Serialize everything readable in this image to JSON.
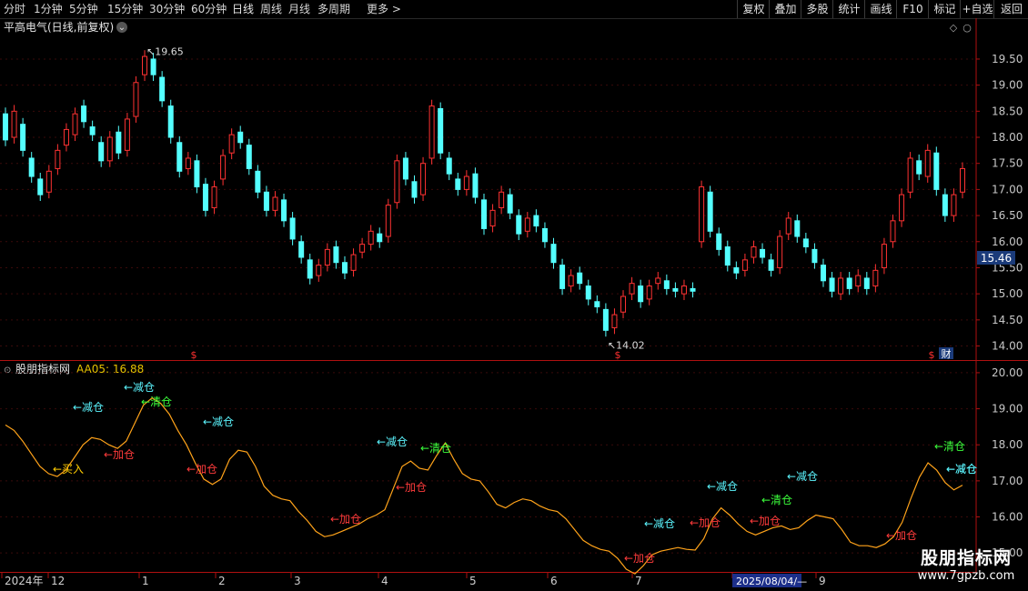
{
  "toolbar": {
    "periods": [
      "分时",
      "1分钟",
      "5分钟",
      "15分钟",
      "30分钟",
      "60分钟",
      "日线",
      "周线",
      "月线",
      "多周期",
      "更多 >"
    ],
    "active_period": "日线",
    "right_buttons": [
      "复权",
      "叠加",
      "多股",
      "统计",
      "画线",
      "F10",
      "标记",
      "+自选",
      "返回"
    ]
  },
  "main_panel": {
    "title": "平高电气(日线,前复权)",
    "high_label": "19.65",
    "low_label": "14.02",
    "current_price": "15.46",
    "price_axis": [
      "19.50",
      "19.00",
      "18.50",
      "18.00",
      "17.50",
      "17.00",
      "16.50",
      "16.00",
      "15.50",
      "15.00",
      "14.50",
      "14.00"
    ],
    "markers": [
      "$",
      "$",
      "$"
    ],
    "finance_badge": "财"
  },
  "indicator_panel": {
    "title": "股朋指标网",
    "value_label": "AA05: 16.88",
    "axis": [
      "20.00",
      "19.00",
      "18.00",
      "17.00",
      "16.00",
      "15.00"
    ],
    "signals": [
      "←减仓",
      "←减仓",
      "←清仓",
      "←加仓",
      "←买入",
      "←减仓",
      "←加仓",
      "←减仓",
      "←清仓",
      "←加仓",
      "←加仓",
      "←减仓",
      "←加仓",
      "←减仓",
      "←加仓",
      "←减仓",
      "←清仓",
      "←加仓",
      "←减仓",
      "←加仓",
      "←减仓",
      "←清仓"
    ]
  },
  "time_axis": {
    "labels": [
      "2024年",
      "12",
      "1",
      "2",
      "3",
      "4",
      "5",
      "6",
      "7",
      "2025/08/04/—",
      "9"
    ]
  },
  "watermark": {
    "name": "股朋指标网",
    "url": "www.7gpzb.com"
  },
  "colors": {
    "up": "#ff3232",
    "down": "#54ffff",
    "indicator_line": "#ffa31a",
    "axis": "#b01010",
    "add": "#ff3b3b",
    "reduce": "#5cf6ff",
    "clear": "#3cff3c",
    "buy": "#ffcc00"
  },
  "chart_data": {
    "type": "candlestick",
    "y_range": [
      13.8,
      19.9
    ],
    "high": 19.65,
    "low": 14.02,
    "last": 15.46,
    "indicator": {
      "name": "AA05",
      "last": 16.88,
      "y_range": [
        14.6,
        20.2
      ],
      "values": [
        18.55,
        18.4,
        18.1,
        17.75,
        17.4,
        17.2,
        17.12,
        17.3,
        17.65,
        18.0,
        18.2,
        18.15,
        18.0,
        17.9,
        18.1,
        18.6,
        19.1,
        19.3,
        19.15,
        18.85,
        18.4,
        18.0,
        17.5,
        17.05,
        16.9,
        17.05,
        17.6,
        17.85,
        17.8,
        17.4,
        16.85,
        16.6,
        16.5,
        16.45,
        16.15,
        15.9,
        15.6,
        15.45,
        15.5,
        15.6,
        15.7,
        15.8,
        15.95,
        16.05,
        16.2,
        16.8,
        17.4,
        17.55,
        17.35,
        17.3,
        17.7,
        18.05,
        17.6,
        17.2,
        17.05,
        17.0,
        16.7,
        16.35,
        16.25,
        16.4,
        16.5,
        16.45,
        16.3,
        16.2,
        16.15,
        15.95,
        15.65,
        15.35,
        15.2,
        15.1,
        15.05,
        14.85,
        14.55,
        14.42,
        14.65,
        14.95,
        15.05,
        15.1,
        15.15,
        15.1,
        15.08,
        15.4,
        15.95,
        16.25,
        16.05,
        15.8,
        15.6,
        15.5,
        15.6,
        15.7,
        15.75,
        15.65,
        15.7,
        15.9,
        16.05,
        16.0,
        15.95,
        15.65,
        15.3,
        15.2,
        15.2,
        15.15,
        15.25,
        15.45,
        15.85,
        16.5,
        17.1,
        17.5,
        17.3,
        16.95,
        16.75,
        16.88
      ]
    },
    "candles": [
      {
        "o": 18.45,
        "c": 17.95
      },
      {
        "o": 18.0,
        "c": 18.5
      },
      {
        "o": 18.25,
        "c": 17.75
      },
      {
        "o": 17.6,
        "c": 17.25
      },
      {
        "o": 17.2,
        "c": 16.9
      },
      {
        "o": 16.95,
        "c": 17.35
      },
      {
        "o": 17.4,
        "c": 17.75
      },
      {
        "o": 17.85,
        "c": 18.15
      },
      {
        "o": 18.05,
        "c": 18.45
      },
      {
        "o": 18.6,
        "c": 18.3
      },
      {
        "o": 18.2,
        "c": 18.05
      },
      {
        "o": 17.9,
        "c": 17.55
      },
      {
        "o": 17.55,
        "c": 18.0
      },
      {
        "o": 18.1,
        "c": 17.7
      },
      {
        "o": 17.75,
        "c": 18.35
      },
      {
        "o": 18.4,
        "c": 19.05
      },
      {
        "o": 19.2,
        "c": 19.55
      },
      {
        "o": 19.5,
        "c": 19.2
      },
      {
        "o": 19.15,
        "c": 18.7
      },
      {
        "o": 18.6,
        "c": 18.0
      },
      {
        "o": 17.9,
        "c": 17.35
      },
      {
        "o": 17.4,
        "c": 17.6
      },
      {
        "o": 17.55,
        "c": 17.05
      },
      {
        "o": 17.1,
        "c": 16.6
      },
      {
        "o": 16.65,
        "c": 17.05
      },
      {
        "o": 17.2,
        "c": 17.65
      },
      {
        "o": 17.7,
        "c": 18.05
      },
      {
        "o": 18.1,
        "c": 17.9
      },
      {
        "o": 17.85,
        "c": 17.4
      },
      {
        "o": 17.35,
        "c": 16.95
      },
      {
        "o": 16.95,
        "c": 16.6
      },
      {
        "o": 16.6,
        "c": 16.85
      },
      {
        "o": 16.8,
        "c": 16.4
      },
      {
        "o": 16.45,
        "c": 16.05
      },
      {
        "o": 16.0,
        "c": 15.7
      },
      {
        "o": 15.65,
        "c": 15.3
      },
      {
        "o": 15.35,
        "c": 15.55
      },
      {
        "o": 15.55,
        "c": 15.85
      },
      {
        "o": 15.9,
        "c": 15.6
      },
      {
        "o": 15.6,
        "c": 15.4
      },
      {
        "o": 15.45,
        "c": 15.75
      },
      {
        "o": 15.8,
        "c": 15.95
      },
      {
        "o": 15.95,
        "c": 16.2
      },
      {
        "o": 16.15,
        "c": 16.0
      },
      {
        "o": 16.1,
        "c": 16.7
      },
      {
        "o": 16.75,
        "c": 17.55
      },
      {
        "o": 17.6,
        "c": 17.2
      },
      {
        "o": 17.15,
        "c": 16.85
      },
      {
        "o": 16.9,
        "c": 17.5
      },
      {
        "o": 17.6,
        "c": 18.6
      },
      {
        "o": 18.55,
        "c": 17.7
      },
      {
        "o": 17.6,
        "c": 17.3
      },
      {
        "o": 17.2,
        "c": 17.0
      },
      {
        "o": 17.0,
        "c": 17.25
      },
      {
        "o": 17.3,
        "c": 16.85
      },
      {
        "o": 16.8,
        "c": 16.25
      },
      {
        "o": 16.3,
        "c": 16.6
      },
      {
        "o": 16.65,
        "c": 16.95
      },
      {
        "o": 16.9,
        "c": 16.55
      },
      {
        "o": 16.5,
        "c": 16.15
      },
      {
        "o": 16.2,
        "c": 16.45
      },
      {
        "o": 16.5,
        "c": 16.3
      },
      {
        "o": 16.25,
        "c": 16.0
      },
      {
        "o": 15.95,
        "c": 15.6
      },
      {
        "o": 15.55,
        "c": 15.1
      },
      {
        "o": 15.15,
        "c": 15.35
      },
      {
        "o": 15.4,
        "c": 15.2
      },
      {
        "o": 15.15,
        "c": 14.9
      },
      {
        "o": 14.85,
        "c": 14.75
      },
      {
        "o": 14.7,
        "c": 14.3
      },
      {
        "o": 14.35,
        "c": 14.6
      },
      {
        "o": 14.65,
        "c": 14.95
      },
      {
        "o": 15.0,
        "c": 15.2
      },
      {
        "o": 15.15,
        "c": 14.85
      },
      {
        "o": 14.9,
        "c": 15.15
      },
      {
        "o": 15.2,
        "c": 15.3
      },
      {
        "o": 15.25,
        "c": 15.1
      },
      {
        "o": 15.1,
        "c": 15.05
      },
      {
        "o": 15.0,
        "c": 15.15
      },
      {
        "o": 15.1,
        "c": 15.05
      },
      {
        "o": 16.0,
        "c": 17.05
      },
      {
        "o": 16.95,
        "c": 16.2
      },
      {
        "o": 16.15,
        "c": 15.85
      },
      {
        "o": 15.9,
        "c": 15.55
      },
      {
        "o": 15.5,
        "c": 15.4
      },
      {
        "o": 15.45,
        "c": 15.65
      },
      {
        "o": 15.7,
        "c": 15.9
      },
      {
        "o": 15.85,
        "c": 15.7
      },
      {
        "o": 15.65,
        "c": 15.45
      },
      {
        "o": 15.5,
        "c": 16.1
      },
      {
        "o": 16.15,
        "c": 16.45
      },
      {
        "o": 16.4,
        "c": 16.1
      },
      {
        "o": 16.05,
        "c": 15.9
      },
      {
        "o": 15.85,
        "c": 15.6
      },
      {
        "o": 15.55,
        "c": 15.25
      },
      {
        "o": 15.3,
        "c": 15.05
      },
      {
        "o": 15.0,
        "c": 15.3
      },
      {
        "o": 15.3,
        "c": 15.1
      },
      {
        "o": 15.15,
        "c": 15.35
      },
      {
        "o": 15.3,
        "c": 15.1
      },
      {
        "o": 15.15,
        "c": 15.45
      },
      {
        "o": 15.5,
        "c": 15.95
      },
      {
        "o": 16.0,
        "c": 16.4
      },
      {
        "o": 16.4,
        "c": 16.9
      },
      {
        "o": 16.95,
        "c": 17.6
      },
      {
        "o": 17.55,
        "c": 17.3
      },
      {
        "o": 17.25,
        "c": 17.75
      },
      {
        "o": 17.7,
        "c": 17.0
      },
      {
        "o": 16.9,
        "c": 16.5
      },
      {
        "o": 16.5,
        "c": 16.9
      },
      {
        "o": 16.95,
        "c": 17.4
      }
    ]
  }
}
